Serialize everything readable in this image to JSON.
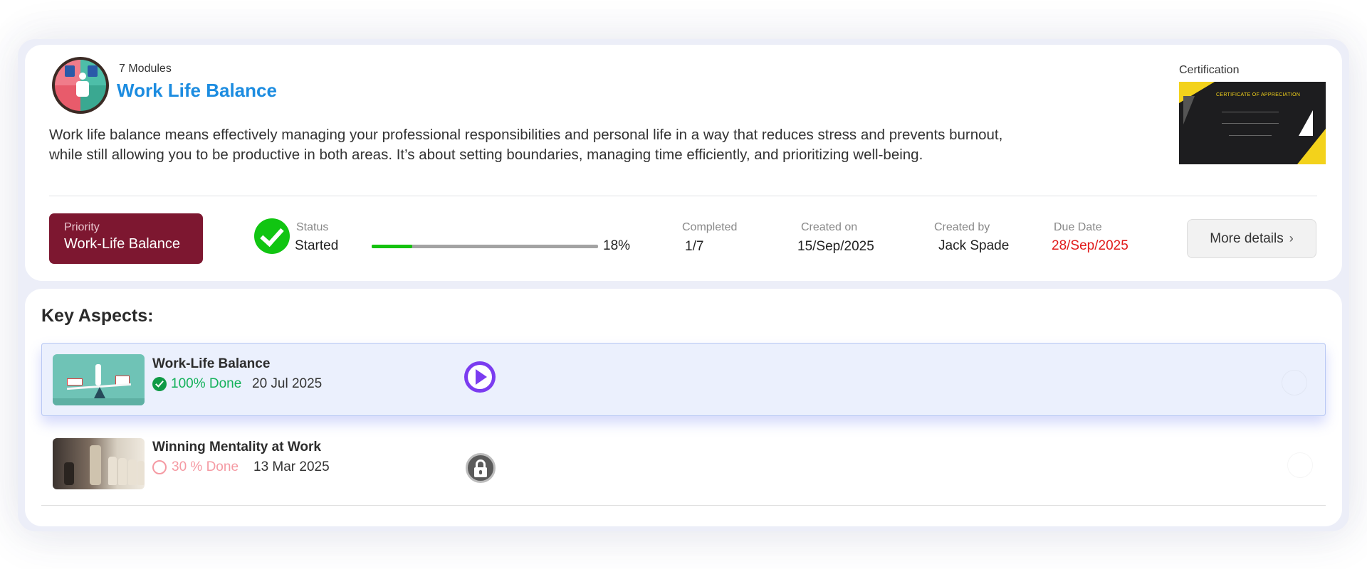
{
  "course": {
    "modules_label": "7 Modules",
    "title": "Work Life Balance",
    "description": "Work life balance means effectively managing your professional responsibilities and personal life in a way that reduces stress and prevents burnout, while still allowing you to be productive in both areas. It’s about setting boundaries, managing time efficiently, and prioritizing well-being.",
    "icon": "work-life-balance-icon"
  },
  "certification": {
    "label": "Certification",
    "heading": "CERTIFICATE OF APPRECIATION"
  },
  "priority": {
    "label": "Priority",
    "value": "Work-Life Balance"
  },
  "status": {
    "label": "Status",
    "value": "Started",
    "progress_percent": 18,
    "progress_label": "18%"
  },
  "completed": {
    "label": "Completed",
    "value": "1/7"
  },
  "created_on": {
    "label": "Created on",
    "value": "15/Sep/2025"
  },
  "created_by": {
    "label": "Created by",
    "value": "Jack Spade"
  },
  "due_date": {
    "label": "Due Date",
    "value": "28/Sep/2025"
  },
  "more_details": {
    "label": "More details",
    "icon": "chevron-right-icon"
  },
  "key_aspects": {
    "title": "Key Aspects:",
    "items": [
      {
        "title": "Work-Life Balance",
        "done_label": "100% Done",
        "date": "20 Jul 2025",
        "action": "play-icon",
        "active": true
      },
      {
        "title": "Winning Mentality at Work",
        "done_label": "30 % Done",
        "date": "13 Mar 2025",
        "action": "lock-icon",
        "active": false
      }
    ]
  },
  "colors": {
    "title_blue": "#1c8ce0",
    "priority_bg": "#7d1730",
    "status_green": "#11c512",
    "due_red": "#e11b1b",
    "done_green": "#13b15a",
    "done_pink": "#f59aa3",
    "play_purple": "#7b3cf0"
  }
}
